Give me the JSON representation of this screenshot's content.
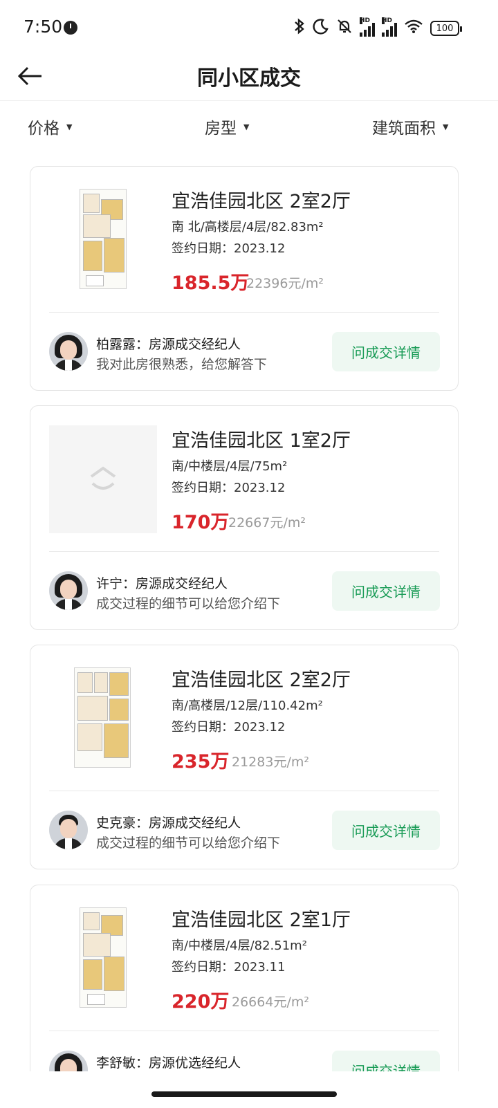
{
  "status_bar": {
    "time": "7:50",
    "battery": "100",
    "icons": [
      "bluetooth-icon",
      "moon-icon",
      "mute-bell-icon",
      "signal-hd-icon",
      "signal-hd-icon",
      "wifi-icon",
      "battery-icon"
    ]
  },
  "header": {
    "title": "同小区成交",
    "back_icon": "arrow-left-icon"
  },
  "filters": [
    {
      "label": "价格"
    },
    {
      "label": "房型"
    },
    {
      "label": "建筑面积"
    }
  ],
  "colors": {
    "price": "#d9252b",
    "accent_green": "#169a54",
    "button_bg": "#eef8f2"
  },
  "listings": [
    {
      "title": "宜浩佳园北区 2室2厅",
      "info": "南 北/高楼层/4层/82.83m²",
      "date": "签约日期：2023.12",
      "price": "185.5万",
      "unit_price": "22396元/m²",
      "agent_name": "柏露露：房源成交经纪人",
      "agent_msg": "我对此房很熟悉，给您解答下",
      "button": "问成交详情"
    },
    {
      "title": "宜浩佳园北区 1室2厅",
      "info": "南/中楼层/4层/75m²",
      "date": "签约日期：2023.12",
      "price": "170万",
      "unit_price": "22667元/m²",
      "agent_name": "许宁：房源成交经纪人",
      "agent_msg": "成交过程的细节可以给您介绍下",
      "button": "问成交详情"
    },
    {
      "title": "宜浩佳园北区 2室2厅",
      "info": "南/高楼层/12层/110.42m²",
      "date": "签约日期：2023.12",
      "price": "235万",
      "unit_price": "21283元/m²",
      "agent_name": "史克豪：房源成交经纪人",
      "agent_msg": "成交过程的细节可以给您介绍下",
      "button": "问成交详情"
    },
    {
      "title": "宜浩佳园北区 2室1厅",
      "info": "南/中楼层/4层/82.51m²",
      "date": "签约日期：2023.11",
      "price": "220万",
      "unit_price": "26664元/m²",
      "agent_name": "李舒敏：房源优选经纪人",
      "agent_msg": "",
      "button": "问成交详情"
    }
  ]
}
